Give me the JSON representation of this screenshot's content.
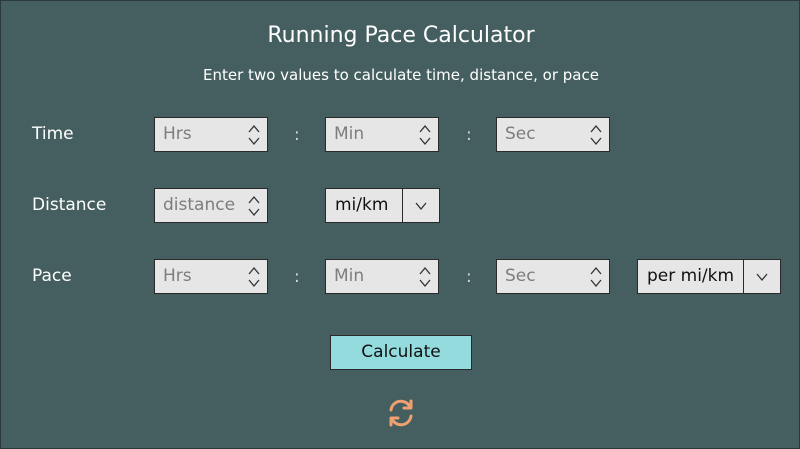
{
  "header": {
    "title": "Running Pace Calculator",
    "subtitle": "Enter two values to calculate time, distance, or pace"
  },
  "rows": {
    "time": {
      "label": "Time",
      "hrs_placeholder": "Hrs",
      "min_placeholder": "Min",
      "sec_placeholder": "Sec"
    },
    "distance": {
      "label": "Distance",
      "distance_placeholder": "distance",
      "unit_selected": "mi/km"
    },
    "pace": {
      "label": "Pace",
      "hrs_placeholder": "Hrs",
      "min_placeholder": "Min",
      "sec_placeholder": "Sec",
      "unit_selected": "per mi/km"
    }
  },
  "separator": ":",
  "actions": {
    "calculate_label": "Calculate",
    "reset_icon": "refresh-icon"
  },
  "colors": {
    "background": "#455f60",
    "button": "#94dbde",
    "reset_icon": "#f0a070"
  }
}
